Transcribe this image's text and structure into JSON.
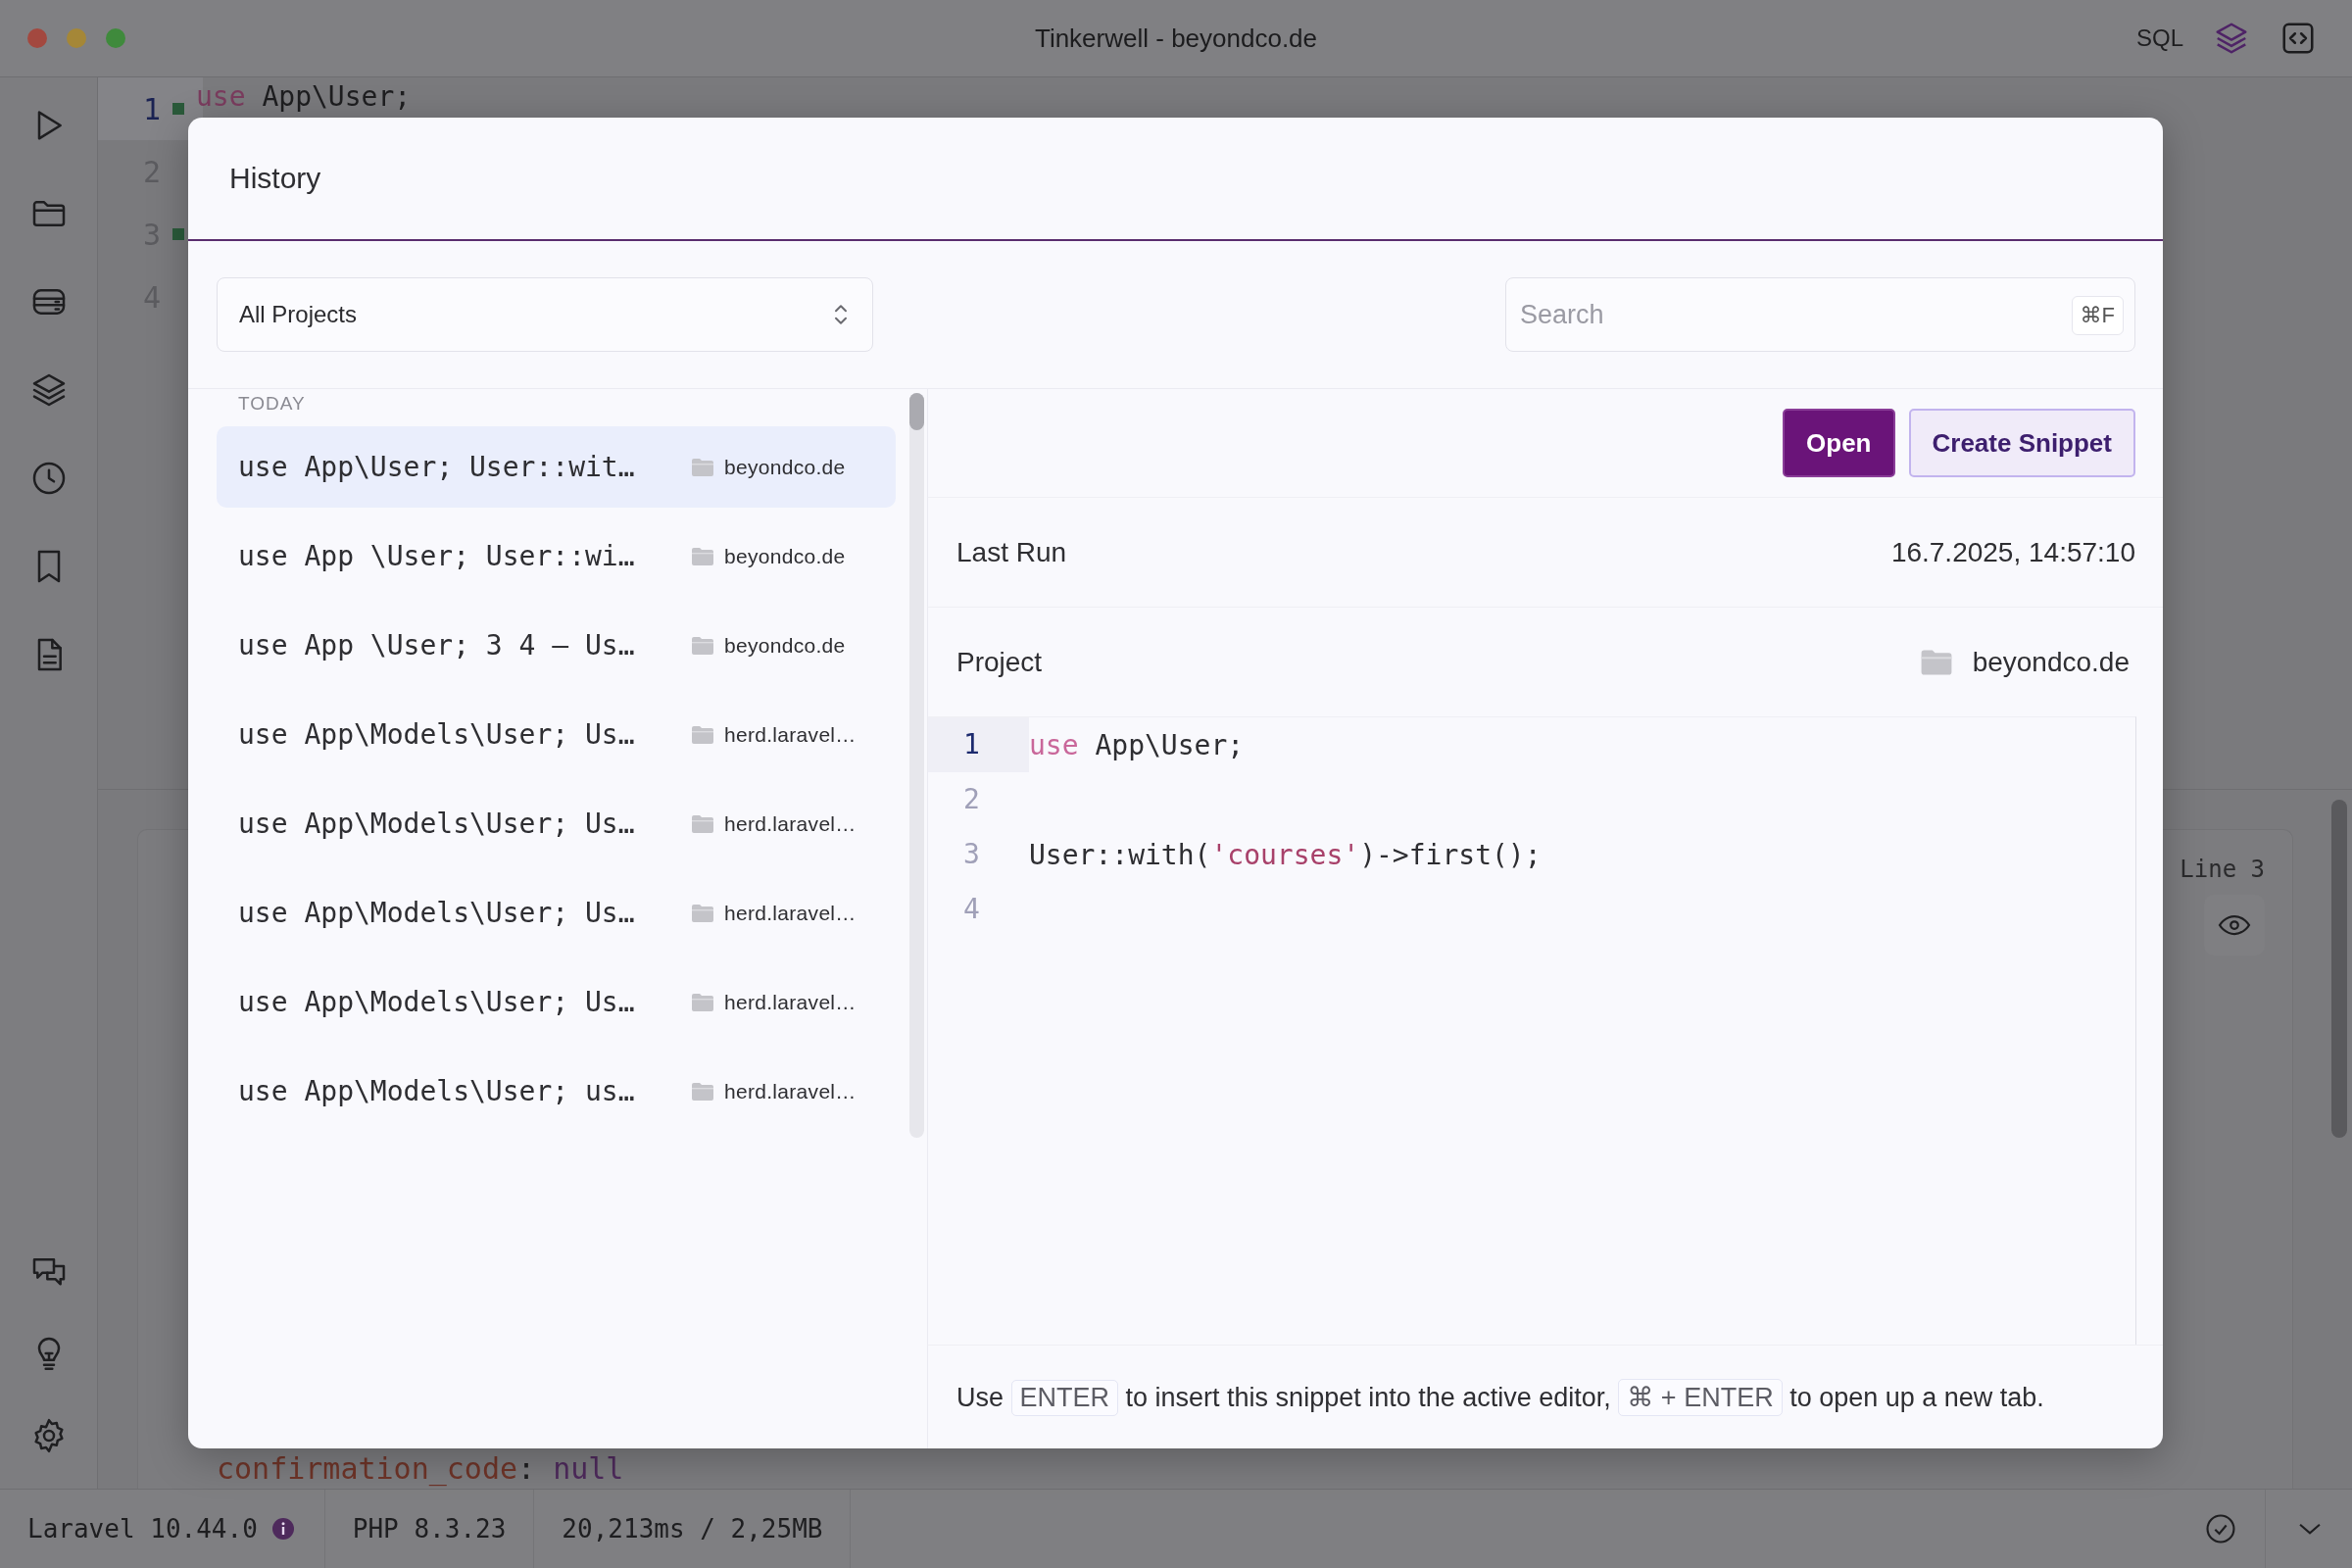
{
  "window": {
    "title": "Tinkerwell - beyondco.de",
    "sql_label": "SQL"
  },
  "editor": {
    "lines": [
      {
        "number": "1",
        "active": true,
        "marker": true,
        "tokens": [
          {
            "kind": "keyword",
            "text": "use"
          },
          {
            "kind": "plain",
            "text": " App\\User;"
          }
        ]
      },
      {
        "number": "2",
        "active": false,
        "marker": false
      },
      {
        "number": "3",
        "active": false,
        "marker": true
      },
      {
        "number": "4",
        "active": false,
        "marker": false
      }
    ]
  },
  "output": {
    "line_label": "Line 3",
    "tokens": [
      {
        "kind": "property",
        "text": "confirmation_code"
      },
      {
        "kind": "plain",
        "text": ": "
      },
      {
        "kind": "null",
        "text": "null"
      }
    ]
  },
  "status_bar": {
    "items": [
      {
        "kind": "framework",
        "text": "Laravel 10.44.0"
      },
      {
        "kind": "plain",
        "text": "PHP 8.3.23"
      },
      {
        "kind": "plain",
        "text": "20,213ms / 2,25MB"
      }
    ]
  },
  "history": {
    "title": "History",
    "project_filter": {
      "value": "All Projects"
    },
    "search": {
      "placeholder": "Search",
      "shortcut": "⌘F"
    },
    "group_label": "TODAY",
    "items": [
      {
        "code": "use App\\User; User::wit…",
        "project": "beyondco.de",
        "selected": true
      },
      {
        "code": "use App \\User; User::wi…",
        "project": "beyondco.de",
        "selected": false
      },
      {
        "code": "use App \\User; 3 4 – Us…",
        "project": "beyondco.de",
        "selected": false
      },
      {
        "code": "use App\\Models\\User; Us…",
        "project": "herd.laravel…",
        "selected": false
      },
      {
        "code": "use App\\Models\\User; Us…",
        "project": "herd.laravel…",
        "selected": false
      },
      {
        "code": "use App\\Models\\User; Us…",
        "project": "herd.laravel…",
        "selected": false
      },
      {
        "code": "use App\\Models\\User; Us…",
        "project": "herd.laravel…",
        "selected": false
      },
      {
        "code": "use App\\Models\\User; us…",
        "project": "herd.laravel…",
        "selected": false
      }
    ],
    "actions": [
      {
        "kind": "primary",
        "label": "Open"
      },
      {
        "kind": "secondary",
        "label": "Create Snippet"
      }
    ],
    "details": [
      {
        "kind": "text",
        "label": "Last Run",
        "value": "16.7.2025, 14:57:10"
      },
      {
        "kind": "project",
        "label": "Project",
        "value": "beyondco.de"
      }
    ],
    "code": {
      "lines": [
        {
          "number": "1",
          "active": true,
          "tokens": [
            {
              "kind": "keyword",
              "text": "use"
            },
            {
              "kind": "plain",
              "text": " App\\User;"
            }
          ]
        },
        {
          "number": "2",
          "active": false
        },
        {
          "number": "3",
          "active": false,
          "tokens": [
            {
              "kind": "plain",
              "text": "User::with("
            },
            {
              "kind": "string",
              "text": "'courses'"
            },
            {
              "kind": "plain",
              "text": ")->first();"
            }
          ]
        },
        {
          "number": "4",
          "active": false
        }
      ]
    },
    "footer": [
      {
        "kind": "text",
        "text": "Use"
      },
      {
        "kind": "key",
        "text": "ENTER"
      },
      {
        "kind": "text",
        "text": "to insert this snippet into the active editor,"
      },
      {
        "kind": "key",
        "text": "⌘ + ENTER"
      },
      {
        "kind": "text",
        "text": "to open up a new tab."
      }
    ]
  }
}
